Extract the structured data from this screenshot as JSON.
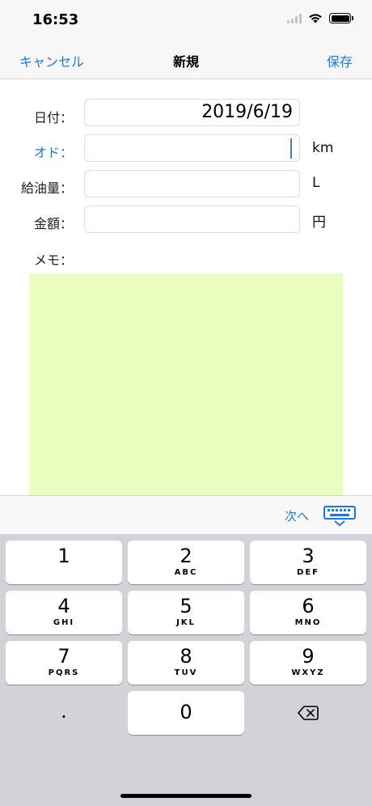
{
  "status_bar": {
    "time": "16:53"
  },
  "nav": {
    "cancel": "キャンセル",
    "title": "新規",
    "save": "保存"
  },
  "form": {
    "date_label": "日付：",
    "date_value": "2019/6/19",
    "odo_label": "オド：",
    "odo_value": "",
    "odo_unit": "km",
    "fuel_label": "給油量：",
    "fuel_value": "",
    "fuel_unit": "L",
    "amount_label": "金額：",
    "amount_value": "",
    "amount_unit": "円",
    "memo_label": "メモ："
  },
  "accessory": {
    "next": "次へ"
  },
  "keyboard": {
    "keys": [
      {
        "num": "1",
        "letters": ""
      },
      {
        "num": "2",
        "letters": "ABC"
      },
      {
        "num": "3",
        "letters": "DEF"
      },
      {
        "num": "4",
        "letters": "GHI"
      },
      {
        "num": "5",
        "letters": "JKL"
      },
      {
        "num": "6",
        "letters": "MNO"
      },
      {
        "num": "7",
        "letters": "PQRS"
      },
      {
        "num": "8",
        "letters": "TUV"
      },
      {
        "num": "9",
        "letters": "WXYZ"
      },
      {
        "num": "0",
        "letters": ""
      }
    ],
    "decimal": "."
  },
  "colors": {
    "accent": "#1b7bd4",
    "memo_background": "#e9fdbf",
    "keyboard_background": "#d1d3d9"
  }
}
